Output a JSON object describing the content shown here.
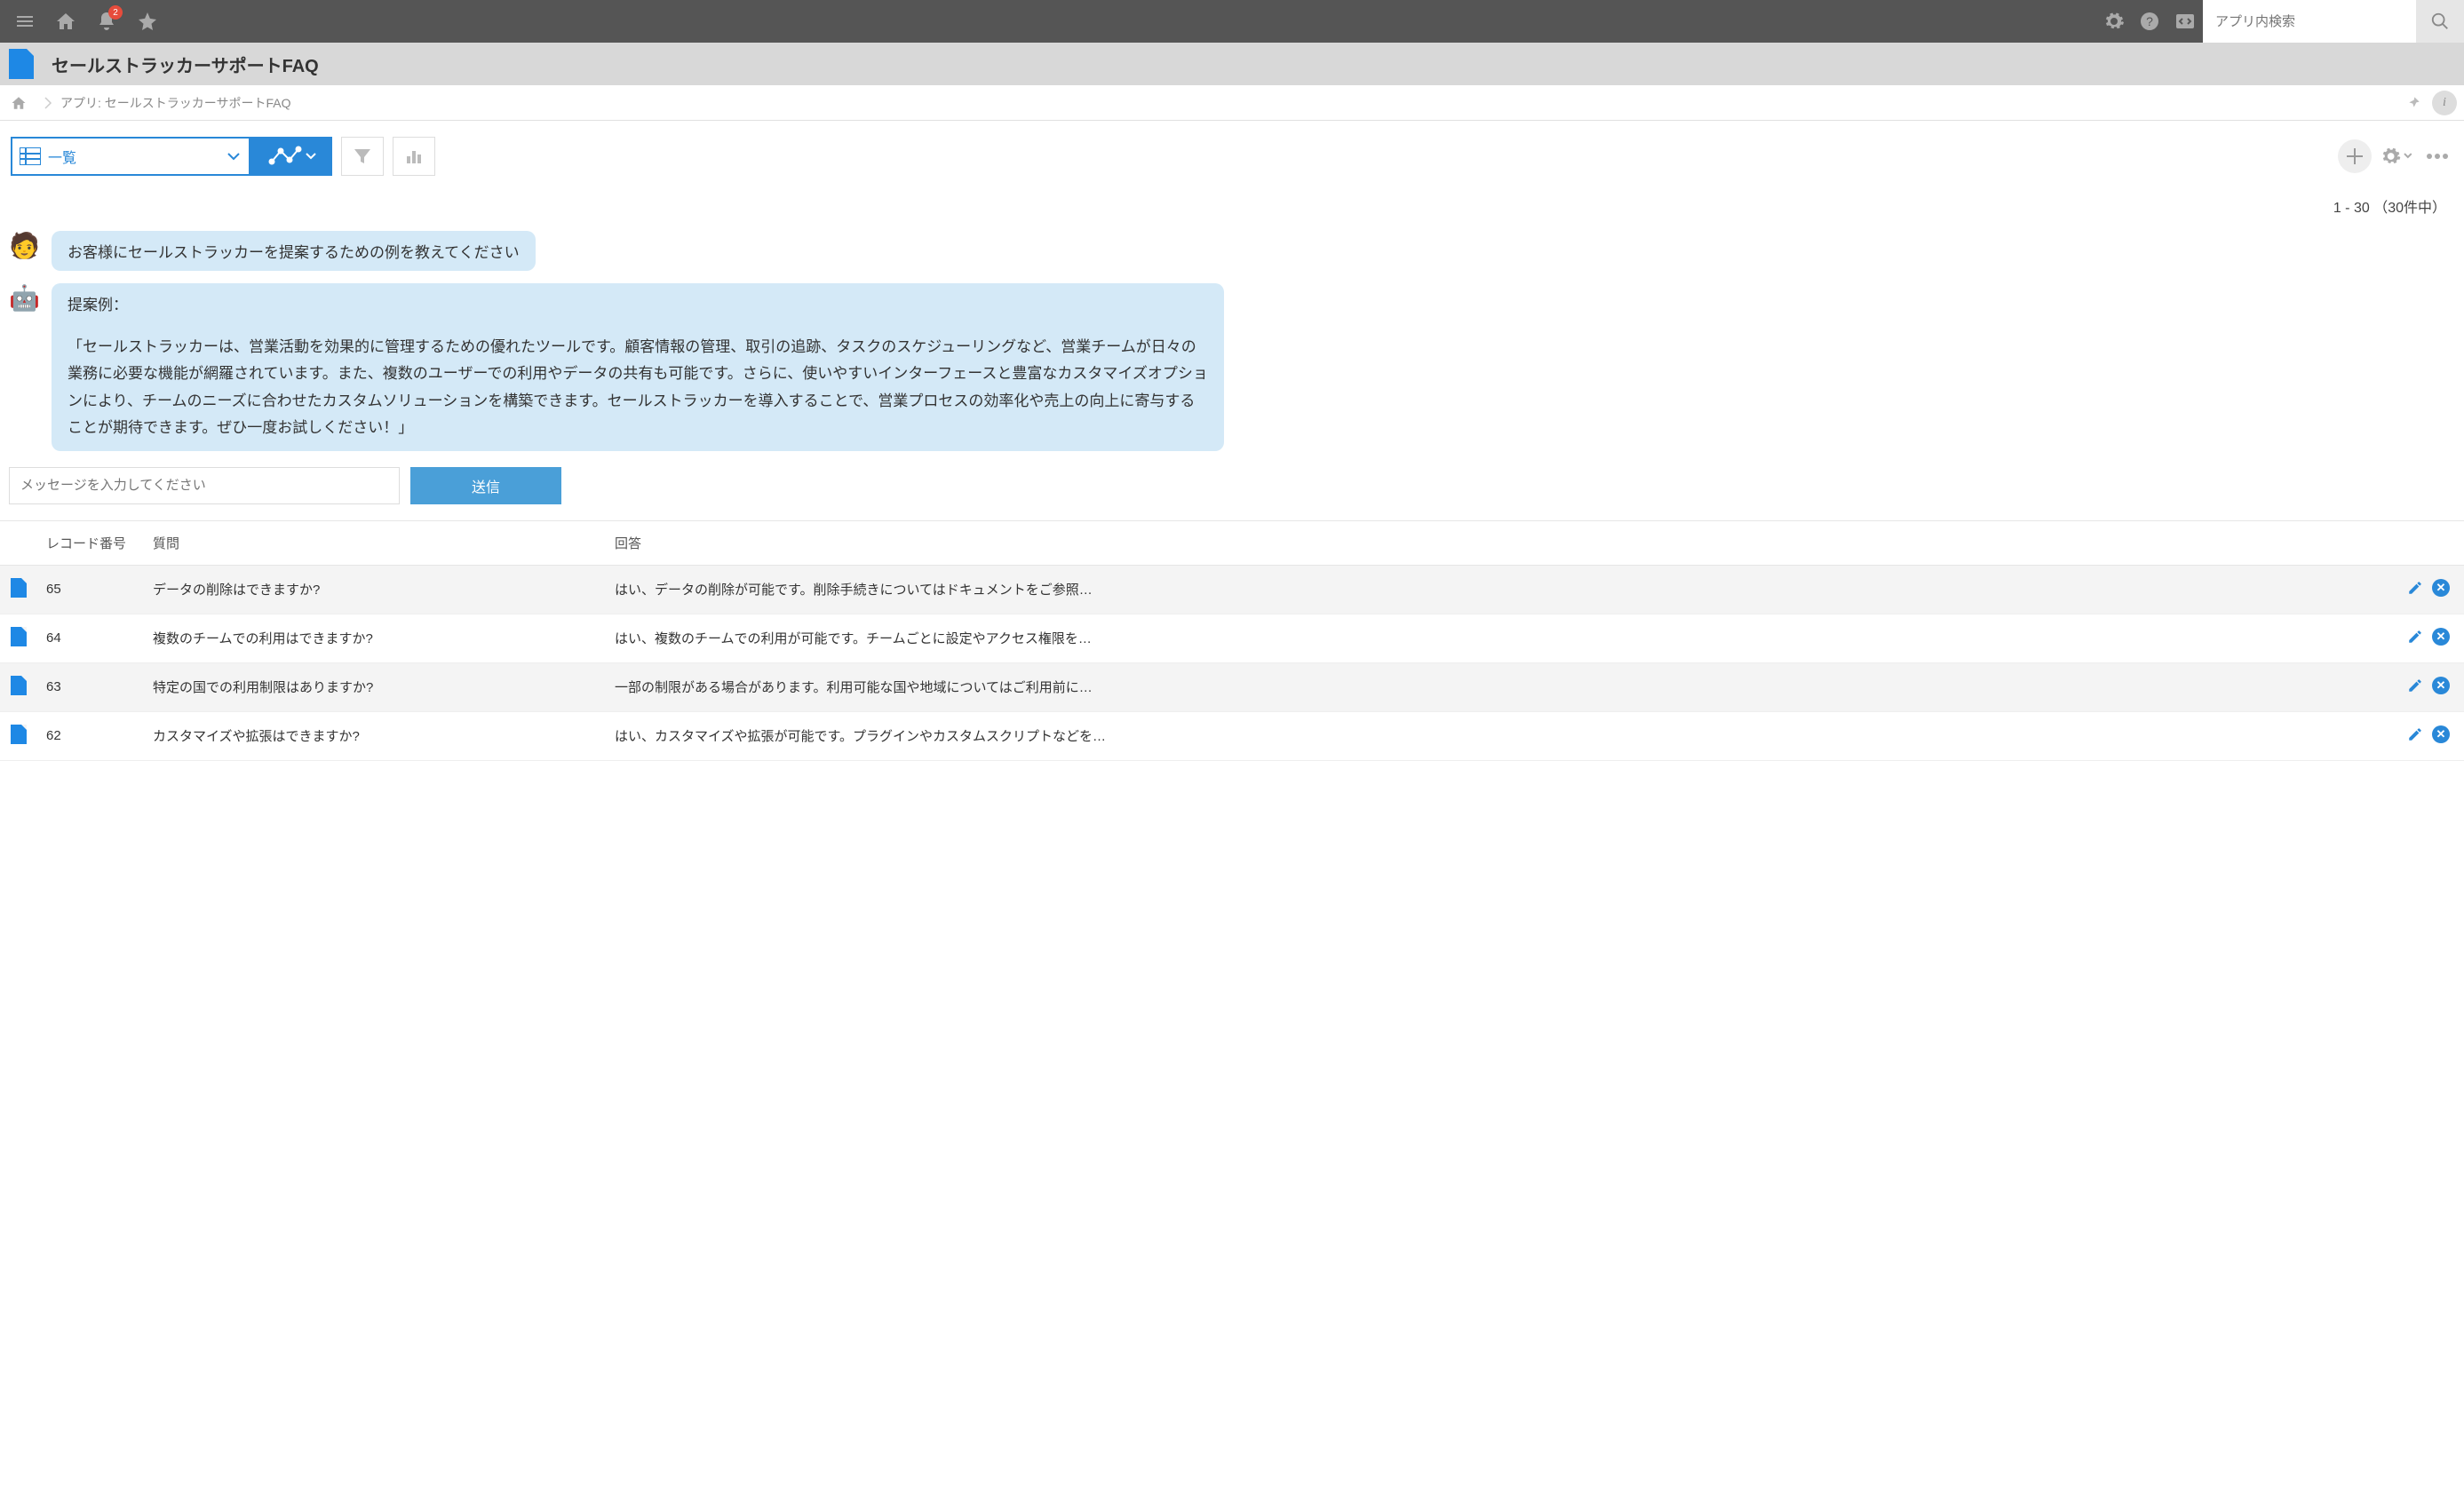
{
  "topbar": {
    "notification_count": "2",
    "search_placeholder": "アプリ内検索"
  },
  "titlebar": {
    "title": "セールストラッカーサポートFAQ"
  },
  "breadcrumb": {
    "text": "アプリ: セールストラッカーサポートFAQ"
  },
  "toolbar": {
    "view_label": "一覧"
  },
  "record_count": "1 - 30 （30件中）",
  "chat": {
    "user_message": "お客様にセールストラッカーを提案するための例を教えてください",
    "bot_heading": "提案例：",
    "bot_body": "「セールストラッカーは、営業活動を効果的に管理するための優れたツールです。顧客情報の管理、取引の追跡、タスクのスケジューリングなど、営業チームが日々の業務に必要な機能が網羅されています。また、複数のユーザーでの利用やデータの共有も可能です。さらに、使いやすいインターフェースと豊富なカスタマイズオプションにより、チームのニーズに合わせたカスタムソリューションを構築できます。セールストラッカーを導入することで、営業プロセスの効率化や売上の向上に寄与することが期待できます。ぜひ一度お試しください！」",
    "input_placeholder": "メッセージを入力してください",
    "send_label": "送信"
  },
  "table": {
    "headers": {
      "record_no": "レコード番号",
      "question": "質問",
      "answer": "回答"
    },
    "rows": [
      {
        "no": "65",
        "q": "データの削除はできますか?",
        "a": "はい、データの削除が可能です。削除手続きについてはドキュメントをご参照…"
      },
      {
        "no": "64",
        "q": "複数のチームでの利用はできますか?",
        "a": "はい、複数のチームでの利用が可能です。チームごとに設定やアクセス権限を…"
      },
      {
        "no": "63",
        "q": "特定の国での利用制限はありますか?",
        "a": "一部の制限がある場合があります。利用可能な国や地域についてはご利用前に…"
      },
      {
        "no": "62",
        "q": "カスタマイズや拡張はできますか?",
        "a": "はい、カスタマイズや拡張が可能です。プラグインやカスタムスクリプトなどを…"
      }
    ]
  }
}
